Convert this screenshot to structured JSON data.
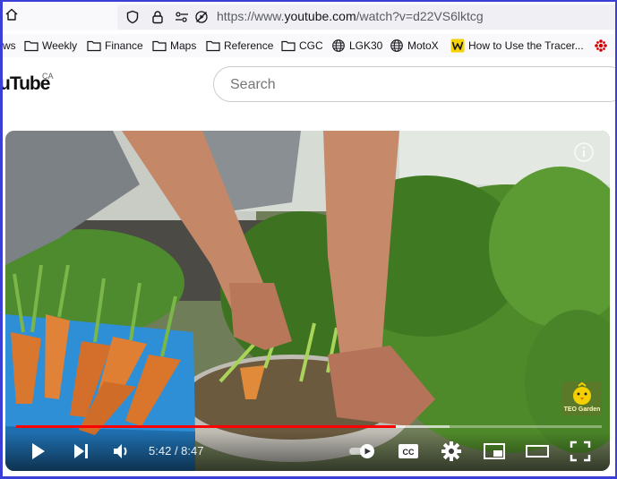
{
  "browser": {
    "url_prefix": "https://www.",
    "url_domain": "youtube.com",
    "url_path": "/watch?v=d22VS6lktcg"
  },
  "bookmarks": [
    {
      "label": "ws",
      "icon": "none"
    },
    {
      "label": "Weekly",
      "icon": "folder-icon"
    },
    {
      "label": "Finance",
      "icon": "folder-icon"
    },
    {
      "label": "Maps",
      "icon": "folder-icon"
    },
    {
      "label": "Reference",
      "icon": "folder-icon"
    },
    {
      "label": "CGC",
      "icon": "folder-icon"
    },
    {
      "label": "LGK30",
      "icon": "globe-icon"
    },
    {
      "label": "MotoX",
      "icon": "globe-icon"
    },
    {
      "label": "How to Use the Tracer...",
      "icon": "w-logo-icon"
    }
  ],
  "youtube": {
    "logo_text": "uTube",
    "region": "CA",
    "search_placeholder": "Search"
  },
  "player": {
    "current_time": "5:42",
    "duration": "8:47",
    "progress_fraction": 0.649,
    "buffered_fraction": 0.74,
    "watermark_text": "TEO Garden",
    "progress_color": "#ff0000"
  }
}
